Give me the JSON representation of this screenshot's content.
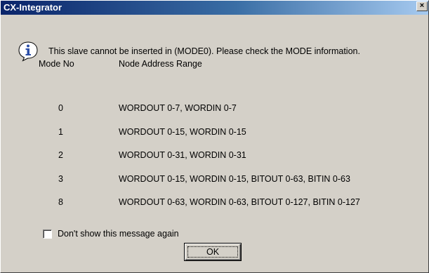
{
  "dialog": {
    "title": "CX-Integrator",
    "close_glyph": "×",
    "icon": "info-icon",
    "message": "This slave cannot be inserted in (MODE0). Please check the MODE information.",
    "headers": {
      "mode": "Mode No",
      "range": "Node Address Range"
    },
    "rows": [
      {
        "mode": "0",
        "range": "WORDOUT 0-7, WORDIN 0-7"
      },
      {
        "mode": "1",
        "range": "WORDOUT 0-15, WORDIN 0-15"
      },
      {
        "mode": "2",
        "range": "WORDOUT 0-31, WORDIN 0-31"
      },
      {
        "mode": "3",
        "range": "WORDOUT 0-15, WORDIN 0-15, BITOUT 0-63, BITIN 0-63"
      },
      {
        "mode": "8",
        "range": "WORDOUT 0-63, WORDIN 0-63, BITOUT 0-127, BITIN 0-127"
      }
    ],
    "checkbox_label": "Don't show this message again",
    "checkbox_checked": false,
    "ok_label": "OK"
  },
  "colors": {
    "titlebar_start": "#0a246a",
    "titlebar_end": "#a6caf0",
    "face": "#d4d0c8",
    "icon_blue": "#2c4fa8"
  }
}
